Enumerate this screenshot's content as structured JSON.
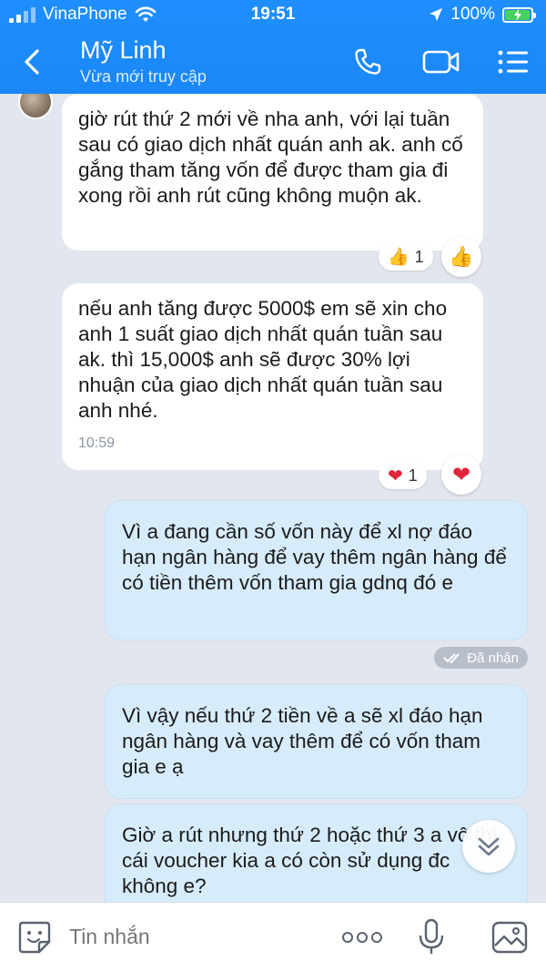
{
  "status_bar": {
    "carrier": "VinaPhone",
    "time": "19:51",
    "battery": "100%"
  },
  "header": {
    "contact_name": "Mỹ Linh",
    "contact_status": "Vừa mới truy cập"
  },
  "messages": [
    {
      "direction": "incoming",
      "text": "giờ rút thứ 2 mới về nha anh, với lại tuần sau có giao dịch nhất quán anh ak. anh cố gắng tham tăng vốn để được tham gia đi xong rồi anh rút cũng không muộn ak.",
      "reaction": {
        "icon": "thumbs-up-icon",
        "count": "1"
      }
    },
    {
      "direction": "incoming",
      "text": "nếu anh tăng được 5000$ em sẽ xin cho anh 1 suất giao dịch nhất quán tuần sau ak. thì 15,000$ anh sẽ được 30% lợi nhuận của giao dịch nhất quán tuần sau anh nhé.",
      "time": "10:59",
      "reaction": {
        "icon": "heart-icon",
        "count": "1"
      }
    },
    {
      "direction": "outgoing",
      "text": "Vì a đang cần số vốn này để xl nợ đáo hạn ngân hàng để vay thêm ngân hàng để có tiền thêm vốn tham gia gdnq đó e",
      "status": "Đã nhận"
    },
    {
      "direction": "outgoing",
      "text": "Vì vậy nếu thứ 2 tiền về a sẽ xl đáo hạn ngân hàng và vay thêm để có vốn tham gia e ạ"
    },
    {
      "direction": "outgoing",
      "text": "Giờ a rút nhưng thứ 2 hoặc thứ 3 a vô thì cái voucher kia a có còn sử dụng đc không e?"
    }
  ],
  "composer": {
    "placeholder": "Tin nhắn"
  },
  "colors": {
    "header_blue": "#1a87f5",
    "outgoing_bubble": "#d7ecfb",
    "incoming_bubble": "#ffffff",
    "chat_background": "#e2e6ee"
  }
}
